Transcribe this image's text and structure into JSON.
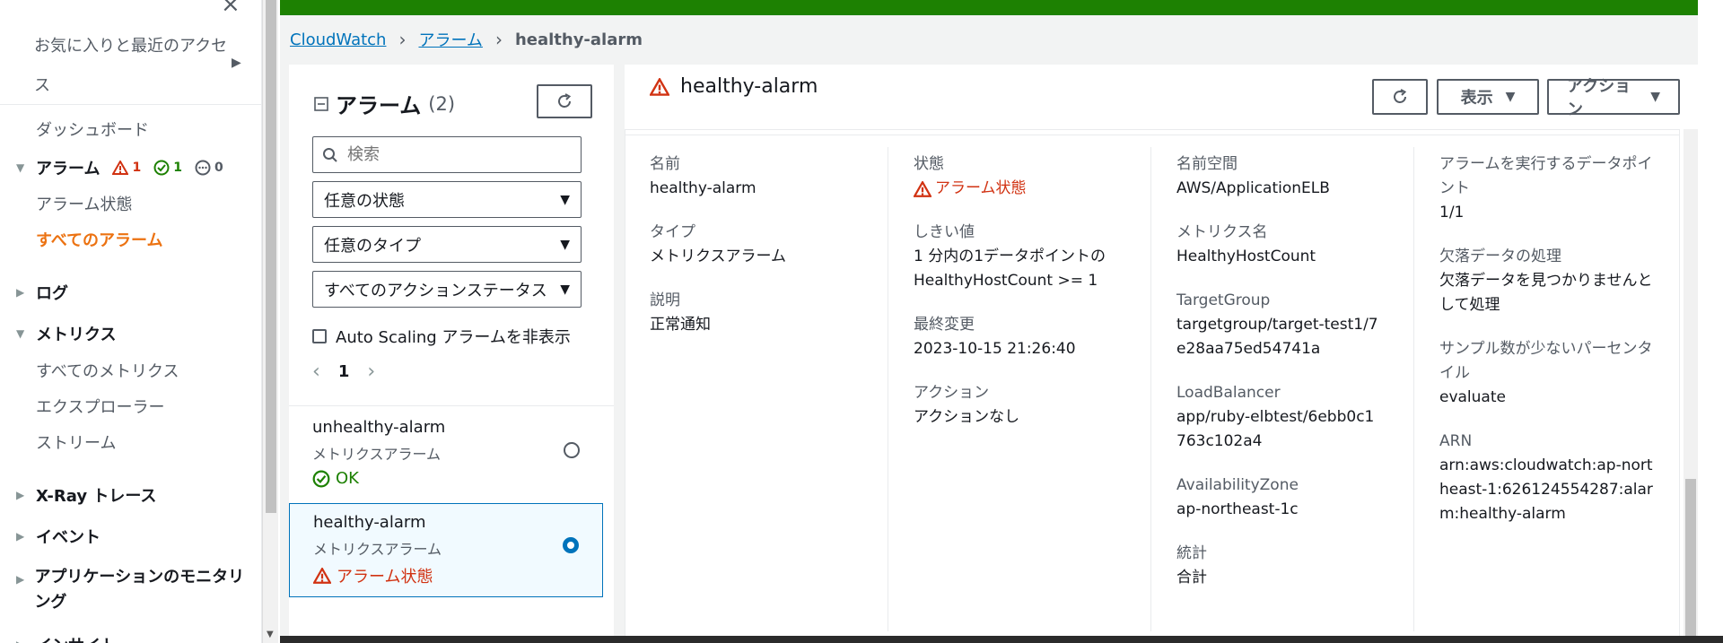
{
  "colors": {
    "accent": "#ec7211",
    "link": "#0073bb",
    "alarm_red": "#d13212",
    "ok_green": "#1d8102",
    "banner_green": "#1d8102"
  },
  "sidebar": {
    "close_icon": "close-icon",
    "recent_label": "お気に入りと最近のアクセス",
    "dashboard": "ダッシュボード",
    "alarms": {
      "label": "アラーム",
      "alarm_count": "1",
      "ok_count": "1",
      "insufficient_count": "0"
    },
    "alarm_state": "アラーム状態",
    "all_alarms": "すべてのアラーム",
    "logs": "ログ",
    "metrics": "メトリクス",
    "all_metrics": "すべてのメトリクス",
    "explorer": "エクスプローラー",
    "streams": "ストリーム",
    "xray": "X-Ray トレース",
    "events": "イベント",
    "app_monitoring": "アプリケーションのモニタリング",
    "insights": "インサイト"
  },
  "breadcrumb": {
    "root": "CloudWatch",
    "section": "アラーム",
    "current": "healthy-alarm"
  },
  "list": {
    "title": "アラーム",
    "count": "(2)",
    "search_placeholder": "検索",
    "filter_state": "任意の状態",
    "filter_type": "任意のタイプ",
    "filter_action": "すべてのアクションステータス",
    "hide_autoscaling": "Auto Scaling アラームを非表示",
    "page": "1",
    "items": [
      {
        "name": "unhealthy-alarm",
        "type": "メトリクスアラーム",
        "state": "OK"
      },
      {
        "name": "healthy-alarm",
        "type": "メトリクスアラーム",
        "state": "アラーム状態"
      }
    ]
  },
  "detail": {
    "title": "healthy-alarm",
    "view_button": "表示",
    "actions_button": "アクション",
    "col1": [
      {
        "label": "名前",
        "value": "healthy-alarm"
      },
      {
        "label": "タイプ",
        "value": "メトリクスアラーム"
      },
      {
        "label": "説明",
        "value": "正常通知"
      }
    ],
    "col2": {
      "state_label": "状態",
      "state_value": "アラーム状態",
      "threshold_label": "しきい値",
      "threshold_value": "1 分内の1データポイントの HealthyHostCount >= 1",
      "last_change_label": "最終変更",
      "last_change_value": "2023-10-15 21:26:40",
      "actions_label": "アクション",
      "actions_value": "アクションなし"
    },
    "col3": [
      {
        "label": "名前空間",
        "value": "AWS/ApplicationELB"
      },
      {
        "label": "メトリクス名",
        "value": "HealthyHostCount"
      },
      {
        "label": "TargetGroup",
        "value": "targetgroup/target-test1/7e28aa75ed54741a"
      },
      {
        "label": "LoadBalancer",
        "value": "app/ruby-elbtest/6ebb0c1763c102a4"
      },
      {
        "label": "AvailabilityZone",
        "value": "ap-northeast-1c"
      },
      {
        "label": "統計",
        "value": "合計"
      }
    ],
    "col4": [
      {
        "label": "アラームを実行するデータポイント",
        "value": "1/1"
      },
      {
        "label": "欠落データの処理",
        "value": "欠落データを見つかりませんとして処理"
      },
      {
        "label": "サンプル数が少ないパーセンタイル",
        "value": "evaluate"
      },
      {
        "label": "ARN",
        "value": "arn:aws:cloudwatch:ap-northeast-1:626124554287:alarm:healthy-alarm"
      }
    ]
  }
}
